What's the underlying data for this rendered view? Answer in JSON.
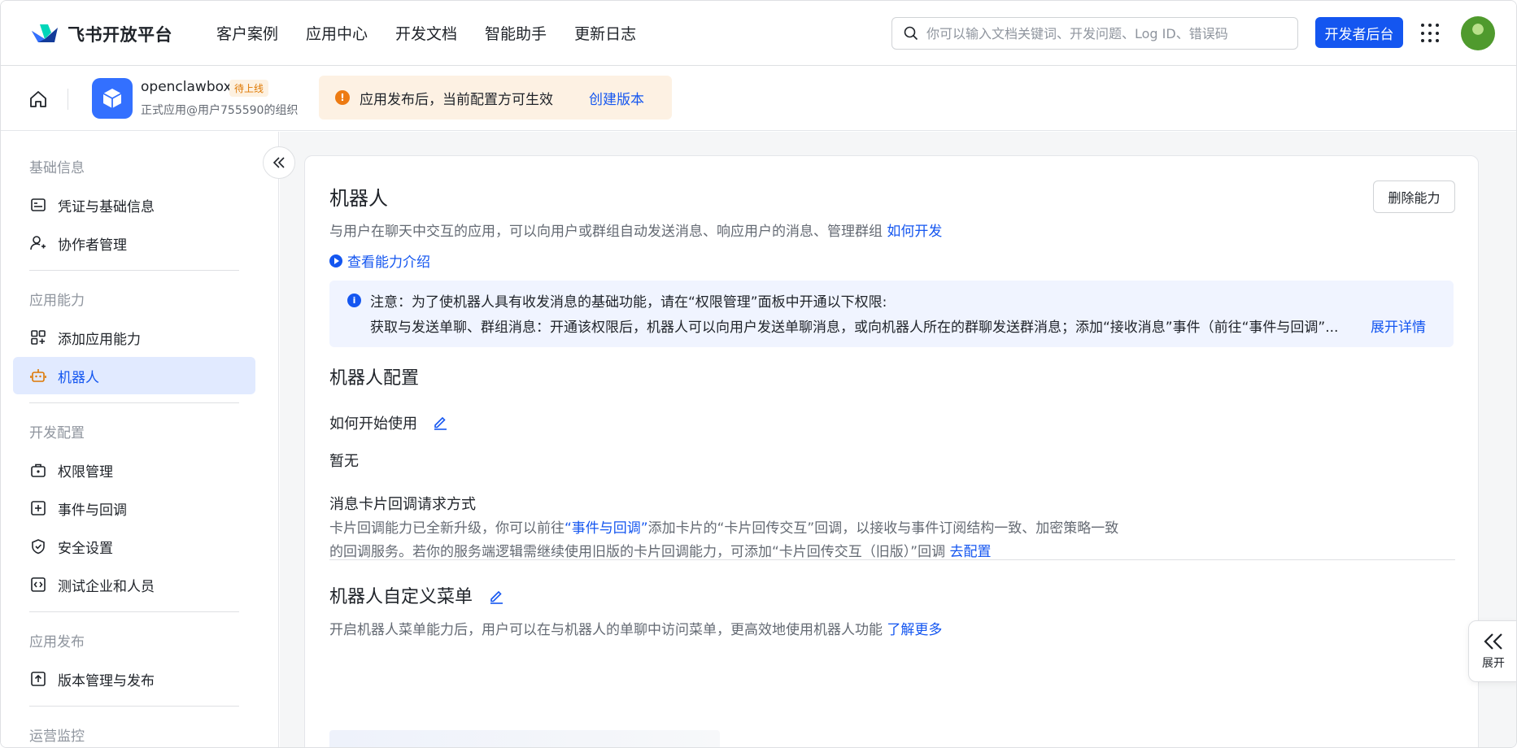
{
  "brand": {
    "name": "飞书开放平台"
  },
  "nav": {
    "items": [
      "客户案例",
      "应用中心",
      "开发文档",
      "智能助手",
      "更新日志"
    ]
  },
  "search": {
    "placeholder": "你可以输入文档关键词、开发问题、Log ID、错误码"
  },
  "header": {
    "dev_console": "开发者后台"
  },
  "app": {
    "name": "openclawbox",
    "status": "待上线",
    "subtitle": "正式应用@用户755590的组织",
    "notice": "应用发布后，当前配置方可生效",
    "notice_action": "创建版本"
  },
  "sidebar": {
    "groups": [
      "基础信息",
      "应用能力",
      "开发配置",
      "应用发布",
      "运营监控"
    ],
    "items": [
      {
        "label": "凭证与基础信息",
        "icon": "credential-icon"
      },
      {
        "label": "协作者管理",
        "icon": "user-add-icon"
      },
      {
        "label": "添加应用能力",
        "icon": "apps-add-icon"
      },
      {
        "label": "机器人",
        "icon": "robot-icon",
        "active": true
      },
      {
        "label": "权限管理",
        "icon": "permission-icon"
      },
      {
        "label": "事件与回调",
        "icon": "event-icon"
      },
      {
        "label": "安全设置",
        "icon": "shield-icon"
      },
      {
        "label": "测试企业和人员",
        "icon": "test-icon"
      },
      {
        "label": "版本管理与发布",
        "icon": "upload-icon"
      }
    ]
  },
  "main": {
    "title": "机器人",
    "delete_label": "删除能力",
    "description": "与用户在聊天中交互的应用，可以向用户或群组自动发送消息、响应用户的消息、管理群组",
    "description_link": "如何开发",
    "intro_link": "查看能力介绍",
    "info": {
      "line1": "注意：为了使机器人具有收发消息的基础功能，请在“权限管理”面板中开通以下权限:",
      "line2": "获取与发送单聊、群组消息：开通该权限后，机器人可以向用户发送单聊消息，或向机器人所在的群聊发送群消息；添加“接收消息”事件（前往“事件与回调”...",
      "more": "展开详情"
    },
    "config": {
      "title": "机器人配置",
      "how_to_use": "如何开始使用",
      "how_to_use_value": "暂无",
      "callback_title": "消息卡片回调请求方式",
      "callback_p1_a": "卡片回调能力已全新升级，你可以前往",
      "callback_p1_link": "“事件与回调”",
      "callback_p1_b": "添加卡片的“卡片回传交互”回调，以接收与事件订阅结构一致、加密策略一致",
      "callback_p2": "的回调服务。若你的服务端逻辑需继续使用旧版的卡片回调能力，可添加“卡片回传交互（旧版）”回调 ",
      "callback_p2_link": "去配置"
    },
    "menu": {
      "title": "机器人自定义菜单",
      "description": "开启机器人菜单能力后，用户可以在与机器人的单聊中访问菜单，更高效地使用机器人功能",
      "description_link": "了解更多"
    }
  },
  "expand": {
    "label": "展开"
  },
  "colors": {
    "accent": "#1456f0",
    "warning": "#ed7b13",
    "active_bg": "#e1eaff"
  }
}
